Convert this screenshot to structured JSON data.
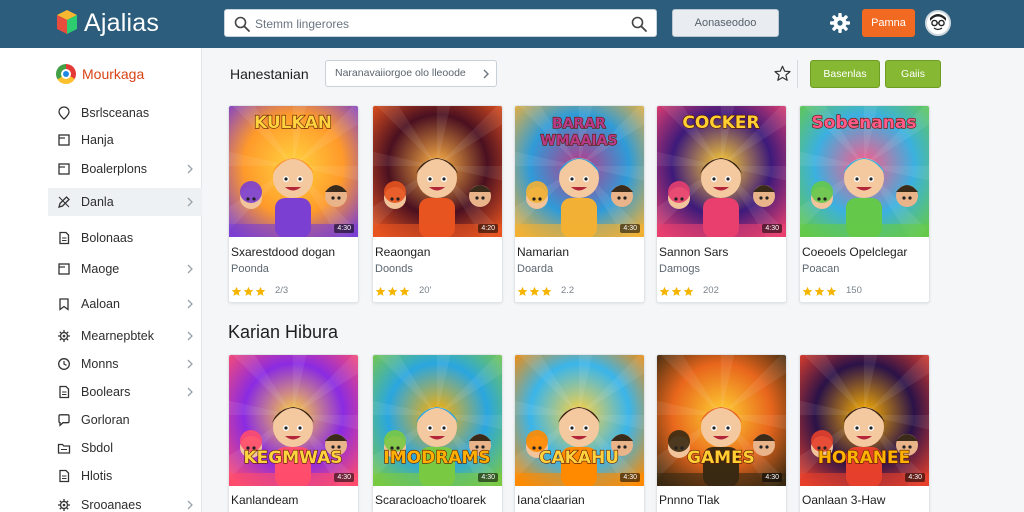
{
  "app": {
    "brand": "Ajalias"
  },
  "header": {
    "search_placeholder": "Stemm lingerores",
    "button_label": "Aonaseodoo",
    "orange_button_label": "Pamna"
  },
  "sidebar": {
    "heading": "Mourkaga",
    "items": [
      {
        "label": "Bsrlsceanas",
        "icon": "map-pin-icon",
        "chevron": false,
        "active": false
      },
      {
        "label": "Hanja",
        "icon": "square-icon",
        "chevron": false,
        "active": false
      },
      {
        "label": "Boalerplons",
        "icon": "square-icon",
        "chevron": true,
        "active": false
      },
      {
        "label": "Danla",
        "icon": "pen-icon",
        "chevron": true,
        "active": true
      },
      {
        "label": "Bolonaas",
        "icon": "document-icon",
        "chevron": false,
        "active": false
      },
      {
        "label": "Maoge",
        "icon": "square-icon",
        "chevron": true,
        "active": false
      },
      {
        "label": "Aaloan",
        "icon": "bookmark-icon",
        "chevron": true,
        "active": false
      },
      {
        "label": "Mearnepbtek",
        "icon": "gear-icon",
        "chevron": true,
        "active": false
      },
      {
        "label": "Monns",
        "icon": "clock-icon",
        "chevron": true,
        "active": false
      },
      {
        "label": "Boolears",
        "icon": "document-icon",
        "chevron": true,
        "active": false
      },
      {
        "label": "Gorloran",
        "icon": "chat-icon",
        "chevron": false,
        "active": false
      },
      {
        "label": "Sbdol",
        "icon": "folder-icon",
        "chevron": false,
        "active": false
      },
      {
        "label": "Hlotis",
        "icon": "document-icon",
        "chevron": false,
        "active": false
      },
      {
        "label": "Srooanaes",
        "icon": "gear-icon",
        "chevron": true,
        "active": false
      }
    ]
  },
  "main": {
    "section1_title": "Hanestanian",
    "filter_label": "Naranavaiiorgoe olo lleoode",
    "action_button_1": "Basenlas",
    "action_button_2": "Gaiis",
    "section2_title": "Karian Hibura",
    "row1": [
      {
        "art_text": "KULKAN",
        "title": "Sxarestdood dogan",
        "subtitle": "Poonda",
        "rating": "2/3",
        "stars": 3,
        "badge": "4:30"
      },
      {
        "art_text": "",
        "title": "Reaongan",
        "subtitle": "Doonds",
        "rating": "20'",
        "stars": 3,
        "badge": "4:20"
      },
      {
        "art_text": "BARAR WMAAIAS",
        "title": "Namarian",
        "subtitle": "Doarda",
        "rating": "2.2",
        "stars": 3,
        "badge": "4:30"
      },
      {
        "art_text": "COCKER",
        "title": "Sannon Sars",
        "subtitle": "Damogs",
        "rating": "202",
        "stars": 3,
        "badge": "4:30"
      },
      {
        "art_text": "Sobenanas",
        "title": "Coeoels Opelclegar",
        "subtitle": "Poacan",
        "rating": "150",
        "stars": 3,
        "badge": ""
      }
    ],
    "row2": [
      {
        "art_text": "KEGMWAS",
        "title": "Kanlandeam",
        "badge": "4:30"
      },
      {
        "art_text": "IMODRAMS",
        "title": "Scaracloacho'tloarek",
        "badge": "4:30"
      },
      {
        "art_text": "CAKAHU",
        "title": "Iana'claarian",
        "badge": "4:30"
      },
      {
        "art_text": "GAMES",
        "title": "Pnnno Tlak",
        "badge": "4:30"
      },
      {
        "art_text": "HORANEE",
        "title": "Oanlaan 3-Haw",
        "badge": "4:30"
      }
    ]
  },
  "colors": {
    "topbar": "#2c5d7c",
    "accent_orange": "#f26a22",
    "accent_green": "#86b833",
    "star": "#f5b400"
  }
}
